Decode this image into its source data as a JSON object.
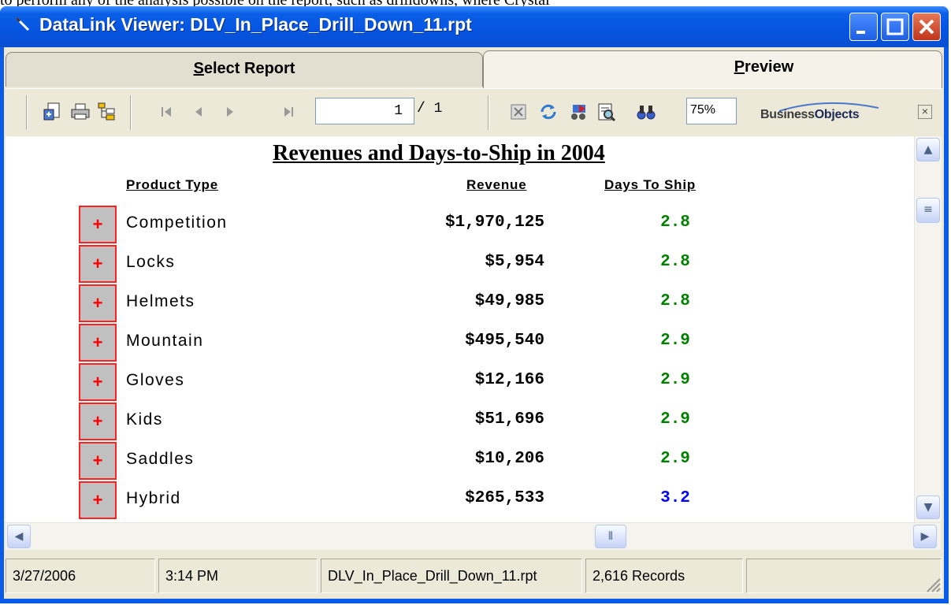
{
  "caption_text": "to perform any of the analysis possible on the report, such as drilldowns, where Crystal",
  "window": {
    "title": "DataLink Viewer:  DLV_In_Place_Drill_Down_11.rpt"
  },
  "tabs": [
    {
      "label_underlined": "S",
      "label_rest": "elect Report"
    },
    {
      "label_underlined": "P",
      "label_rest": "review"
    }
  ],
  "toolbar": {
    "page_current": "1",
    "page_total": "/ 1",
    "zoom": "75%",
    "logo_part1": "Business",
    "logo_part2": "Objects",
    "icons": [
      "export-icon",
      "print-icon",
      "group-tree-icon",
      "first-page-icon",
      "prev-page-icon",
      "next-page-icon",
      "last-page-icon",
      "stop-icon",
      "refresh-icon",
      "toggle-tree-icon",
      "search-icon",
      "find-icon"
    ]
  },
  "report": {
    "title": "Revenues and Days-to-Ship in 2004",
    "headers": {
      "product": "Product Type",
      "revenue": "Revenue",
      "days": "Days To Ship"
    },
    "rows": [
      {
        "drill": "+",
        "product": "Competition",
        "revenue": "$1,970,125",
        "days": "2.8",
        "days_color": "#008000"
      },
      {
        "drill": "+",
        "product": "Locks",
        "revenue": "$5,954",
        "days": "2.8",
        "days_color": "#008000"
      },
      {
        "drill": "+",
        "product": "Helmets",
        "revenue": "$49,985",
        "days": "2.8",
        "days_color": "#008000"
      },
      {
        "drill": "+",
        "product": "Mountain",
        "revenue": "$495,540",
        "days": "2.9",
        "days_color": "#008000"
      },
      {
        "drill": "+",
        "product": "Gloves",
        "revenue": "$12,166",
        "days": "2.9",
        "days_color": "#008000"
      },
      {
        "drill": "+",
        "product": "Kids",
        "revenue": "$51,696",
        "days": "2.9",
        "days_color": "#008000"
      },
      {
        "drill": "+",
        "product": "Saddles",
        "revenue": "$10,206",
        "days": "2.9",
        "days_color": "#008000"
      },
      {
        "drill": "+",
        "product": "Hybrid",
        "revenue": "$265,533",
        "days": "3.2",
        "days_color": "#0000ff"
      }
    ]
  },
  "status": {
    "date": "3/27/2006",
    "time": "3:14 PM",
    "file": "DLV_In_Place_Drill_Down_11.rpt",
    "records": "2,616 Records"
  }
}
